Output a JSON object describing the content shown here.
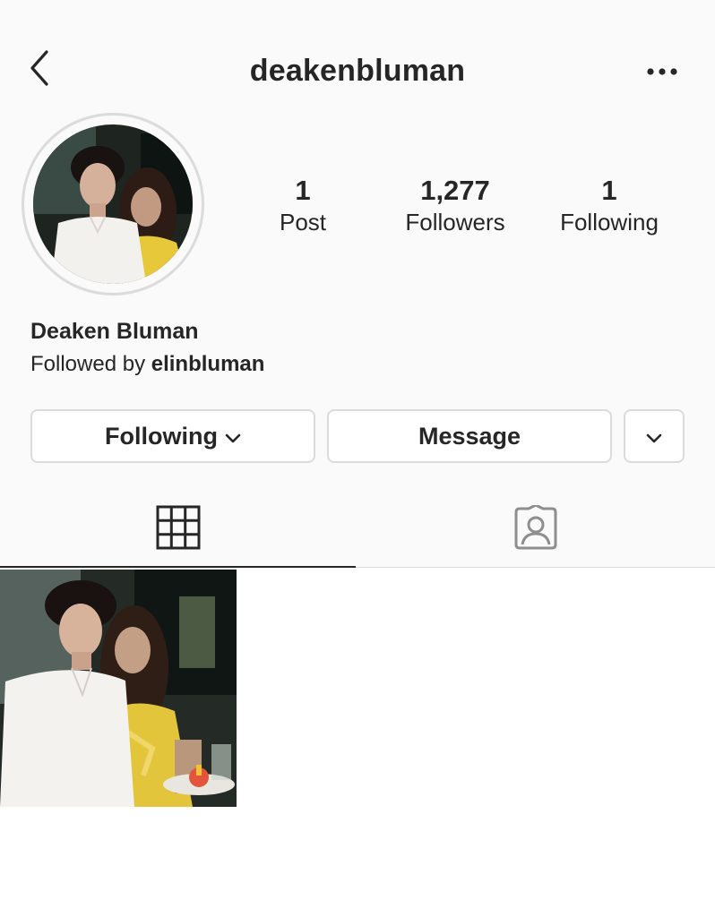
{
  "header": {
    "username": "deakenbluman",
    "back_icon": "chevron-left-icon",
    "more_icon": "more-horizontal-icon"
  },
  "profile": {
    "display_name": "Deaken Bluman",
    "followed_by_prefix": "Followed by",
    "followed_by_user": "elinbluman"
  },
  "stats": {
    "posts": {
      "value": "1",
      "label": "Post"
    },
    "followers": {
      "value": "1,277",
      "label": "Followers"
    },
    "following": {
      "value": "1",
      "label": "Following"
    }
  },
  "actions": {
    "following_label": "Following",
    "message_label": "Message"
  },
  "tabs": [
    {
      "name": "grid",
      "icon": "grid-icon",
      "active": true
    },
    {
      "name": "tagged",
      "icon": "tagged-user-icon",
      "active": false
    }
  ],
  "colors": {
    "text": "#262626",
    "border": "#dbdbdb",
    "background": "#fafafa"
  }
}
